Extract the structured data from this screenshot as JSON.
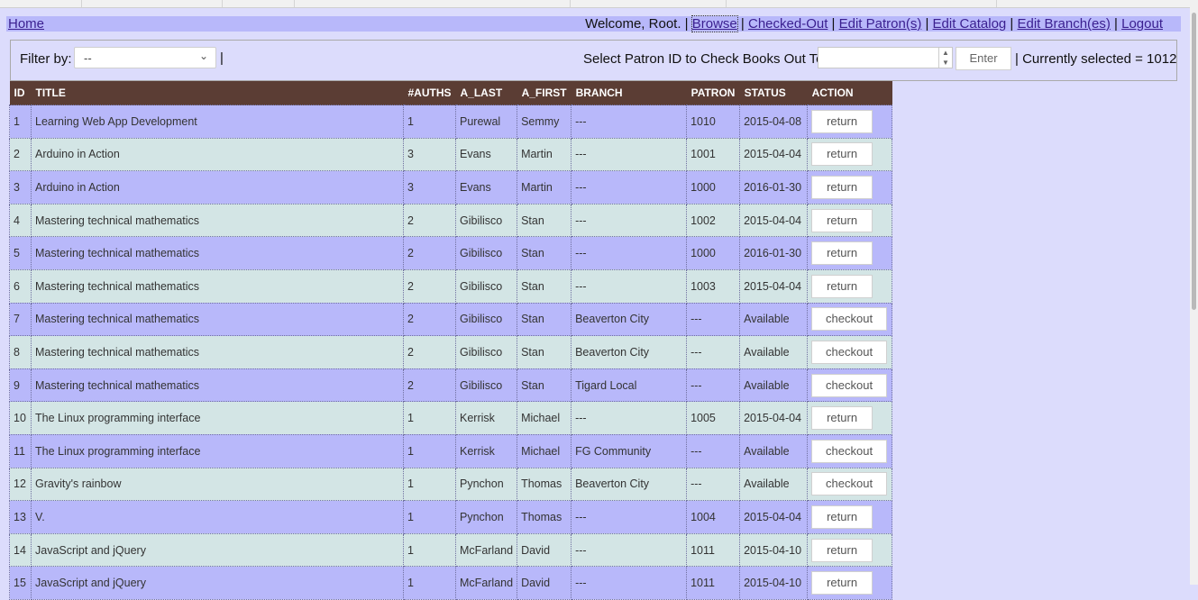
{
  "nav": {
    "home": "Home",
    "welcome": "Welcome, Root.",
    "links": [
      "Browse",
      "Checked-Out",
      "Edit Patron(s)",
      "Edit Catalog",
      "Edit Branch(es)",
      "Logout"
    ]
  },
  "filter": {
    "label": "Filter by:",
    "selected": "--",
    "patron_label": "Select Patron ID to Check Books Out To:",
    "patron_value": "",
    "enter_label": "Enter",
    "currently_selected": "| Currently selected = 1012"
  },
  "table": {
    "headers": [
      "ID",
      "TITLE",
      "#AUTHS",
      "A_LAST",
      "A_FIRST",
      "BRANCH",
      "PATRON",
      "STATUS",
      "ACTION"
    ],
    "rows": [
      {
        "id": "1",
        "title": "Learning Web App Development",
        "auths": "1",
        "last": "Purewal",
        "first": "Semmy",
        "branch": "---",
        "patron": "1010",
        "status": "2015-04-08",
        "action": "return"
      },
      {
        "id": "2",
        "title": "Arduino in Action",
        "auths": "3",
        "last": "Evans",
        "first": "Martin",
        "branch": "---",
        "patron": "1001",
        "status": "2015-04-04",
        "action": "return"
      },
      {
        "id": "3",
        "title": "Arduino in Action",
        "auths": "3",
        "last": "Evans",
        "first": "Martin",
        "branch": "---",
        "patron": "1000",
        "status": "2016-01-30",
        "action": "return"
      },
      {
        "id": "4",
        "title": "Mastering technical mathematics",
        "auths": "2",
        "last": "Gibilisco",
        "first": "Stan",
        "branch": "---",
        "patron": "1002",
        "status": "2015-04-04",
        "action": "return"
      },
      {
        "id": "5",
        "title": "Mastering technical mathematics",
        "auths": "2",
        "last": "Gibilisco",
        "first": "Stan",
        "branch": "---",
        "patron": "1000",
        "status": "2016-01-30",
        "action": "return"
      },
      {
        "id": "6",
        "title": "Mastering technical mathematics",
        "auths": "2",
        "last": "Gibilisco",
        "first": "Stan",
        "branch": "---",
        "patron": "1003",
        "status": "2015-04-04",
        "action": "return"
      },
      {
        "id": "7",
        "title": "Mastering technical mathematics",
        "auths": "2",
        "last": "Gibilisco",
        "first": "Stan",
        "branch": "Beaverton City",
        "patron": "---",
        "status": "Available",
        "action": "checkout"
      },
      {
        "id": "8",
        "title": "Mastering technical mathematics",
        "auths": "2",
        "last": "Gibilisco",
        "first": "Stan",
        "branch": "Beaverton City",
        "patron": "---",
        "status": "Available",
        "action": "checkout"
      },
      {
        "id": "9",
        "title": "Mastering technical mathematics",
        "auths": "2",
        "last": "Gibilisco",
        "first": "Stan",
        "branch": "Tigard Local",
        "patron": "---",
        "status": "Available",
        "action": "checkout"
      },
      {
        "id": "10",
        "title": "The Linux programming interface",
        "auths": "1",
        "last": "Kerrisk",
        "first": "Michael",
        "branch": "---",
        "patron": "1005",
        "status": "2015-04-04",
        "action": "return"
      },
      {
        "id": "11",
        "title": "The Linux programming interface",
        "auths": "1",
        "last": "Kerrisk",
        "first": "Michael",
        "branch": "FG Community",
        "patron": "---",
        "status": "Available",
        "action": "checkout"
      },
      {
        "id": "12",
        "title": "Gravity's rainbow",
        "auths": "1",
        "last": "Pynchon",
        "first": "Thomas",
        "branch": "Beaverton City",
        "patron": "---",
        "status": "Available",
        "action": "checkout"
      },
      {
        "id": "13",
        "title": "V.",
        "auths": "1",
        "last": "Pynchon",
        "first": "Thomas",
        "branch": "---",
        "patron": "1004",
        "status": "2015-04-04",
        "action": "return"
      },
      {
        "id": "14",
        "title": "JavaScript and jQuery",
        "auths": "1",
        "last": "McFarland",
        "first": "David",
        "branch": "---",
        "patron": "1011",
        "status": "2015-04-10",
        "action": "return"
      },
      {
        "id": "15",
        "title": "JavaScript and jQuery",
        "auths": "1",
        "last": "McFarland",
        "first": "David",
        "branch": "---",
        "patron": "1011",
        "status": "2015-04-10",
        "action": "return"
      }
    ]
  },
  "colors": {
    "header_bg": "#5b3d34",
    "row_odd": "#b8b8fa",
    "row_even": "#d3e5e5",
    "page_bg": "#dcdcfc"
  }
}
